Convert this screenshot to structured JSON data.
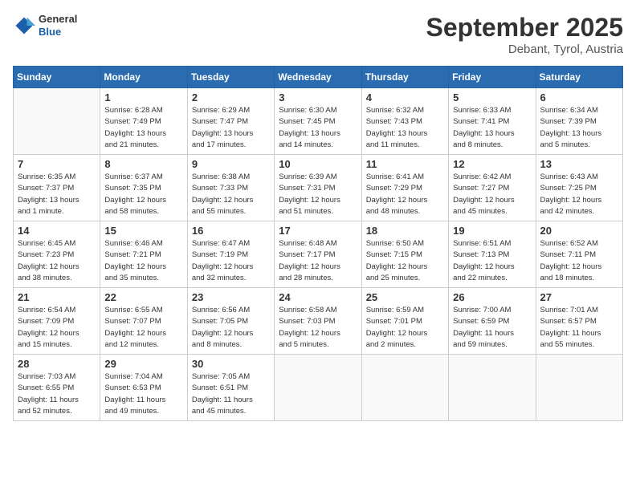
{
  "header": {
    "logo": {
      "general": "General",
      "blue": "Blue"
    },
    "month": "September 2025",
    "location": "Debant, Tyrol, Austria"
  },
  "weekdays": [
    "Sunday",
    "Monday",
    "Tuesday",
    "Wednesday",
    "Thursday",
    "Friday",
    "Saturday"
  ],
  "weeks": [
    [
      {
        "day": "",
        "info": ""
      },
      {
        "day": "1",
        "info": "Sunrise: 6:28 AM\nSunset: 7:49 PM\nDaylight: 13 hours\nand 21 minutes."
      },
      {
        "day": "2",
        "info": "Sunrise: 6:29 AM\nSunset: 7:47 PM\nDaylight: 13 hours\nand 17 minutes."
      },
      {
        "day": "3",
        "info": "Sunrise: 6:30 AM\nSunset: 7:45 PM\nDaylight: 13 hours\nand 14 minutes."
      },
      {
        "day": "4",
        "info": "Sunrise: 6:32 AM\nSunset: 7:43 PM\nDaylight: 13 hours\nand 11 minutes."
      },
      {
        "day": "5",
        "info": "Sunrise: 6:33 AM\nSunset: 7:41 PM\nDaylight: 13 hours\nand 8 minutes."
      },
      {
        "day": "6",
        "info": "Sunrise: 6:34 AM\nSunset: 7:39 PM\nDaylight: 13 hours\nand 5 minutes."
      }
    ],
    [
      {
        "day": "7",
        "info": "Sunrise: 6:35 AM\nSunset: 7:37 PM\nDaylight: 13 hours\nand 1 minute."
      },
      {
        "day": "8",
        "info": "Sunrise: 6:37 AM\nSunset: 7:35 PM\nDaylight: 12 hours\nand 58 minutes."
      },
      {
        "day": "9",
        "info": "Sunrise: 6:38 AM\nSunset: 7:33 PM\nDaylight: 12 hours\nand 55 minutes."
      },
      {
        "day": "10",
        "info": "Sunrise: 6:39 AM\nSunset: 7:31 PM\nDaylight: 12 hours\nand 51 minutes."
      },
      {
        "day": "11",
        "info": "Sunrise: 6:41 AM\nSunset: 7:29 PM\nDaylight: 12 hours\nand 48 minutes."
      },
      {
        "day": "12",
        "info": "Sunrise: 6:42 AM\nSunset: 7:27 PM\nDaylight: 12 hours\nand 45 minutes."
      },
      {
        "day": "13",
        "info": "Sunrise: 6:43 AM\nSunset: 7:25 PM\nDaylight: 12 hours\nand 42 minutes."
      }
    ],
    [
      {
        "day": "14",
        "info": "Sunrise: 6:45 AM\nSunset: 7:23 PM\nDaylight: 12 hours\nand 38 minutes."
      },
      {
        "day": "15",
        "info": "Sunrise: 6:46 AM\nSunset: 7:21 PM\nDaylight: 12 hours\nand 35 minutes."
      },
      {
        "day": "16",
        "info": "Sunrise: 6:47 AM\nSunset: 7:19 PM\nDaylight: 12 hours\nand 32 minutes."
      },
      {
        "day": "17",
        "info": "Sunrise: 6:48 AM\nSunset: 7:17 PM\nDaylight: 12 hours\nand 28 minutes."
      },
      {
        "day": "18",
        "info": "Sunrise: 6:50 AM\nSunset: 7:15 PM\nDaylight: 12 hours\nand 25 minutes."
      },
      {
        "day": "19",
        "info": "Sunrise: 6:51 AM\nSunset: 7:13 PM\nDaylight: 12 hours\nand 22 minutes."
      },
      {
        "day": "20",
        "info": "Sunrise: 6:52 AM\nSunset: 7:11 PM\nDaylight: 12 hours\nand 18 minutes."
      }
    ],
    [
      {
        "day": "21",
        "info": "Sunrise: 6:54 AM\nSunset: 7:09 PM\nDaylight: 12 hours\nand 15 minutes."
      },
      {
        "day": "22",
        "info": "Sunrise: 6:55 AM\nSunset: 7:07 PM\nDaylight: 12 hours\nand 12 minutes."
      },
      {
        "day": "23",
        "info": "Sunrise: 6:56 AM\nSunset: 7:05 PM\nDaylight: 12 hours\nand 8 minutes."
      },
      {
        "day": "24",
        "info": "Sunrise: 6:58 AM\nSunset: 7:03 PM\nDaylight: 12 hours\nand 5 minutes."
      },
      {
        "day": "25",
        "info": "Sunrise: 6:59 AM\nSunset: 7:01 PM\nDaylight: 12 hours\nand 2 minutes."
      },
      {
        "day": "26",
        "info": "Sunrise: 7:00 AM\nSunset: 6:59 PM\nDaylight: 11 hours\nand 59 minutes."
      },
      {
        "day": "27",
        "info": "Sunrise: 7:01 AM\nSunset: 6:57 PM\nDaylight: 11 hours\nand 55 minutes."
      }
    ],
    [
      {
        "day": "28",
        "info": "Sunrise: 7:03 AM\nSunset: 6:55 PM\nDaylight: 11 hours\nand 52 minutes."
      },
      {
        "day": "29",
        "info": "Sunrise: 7:04 AM\nSunset: 6:53 PM\nDaylight: 11 hours\nand 49 minutes."
      },
      {
        "day": "30",
        "info": "Sunrise: 7:05 AM\nSunset: 6:51 PM\nDaylight: 11 hours\nand 45 minutes."
      },
      {
        "day": "",
        "info": ""
      },
      {
        "day": "",
        "info": ""
      },
      {
        "day": "",
        "info": ""
      },
      {
        "day": "",
        "info": ""
      }
    ]
  ]
}
